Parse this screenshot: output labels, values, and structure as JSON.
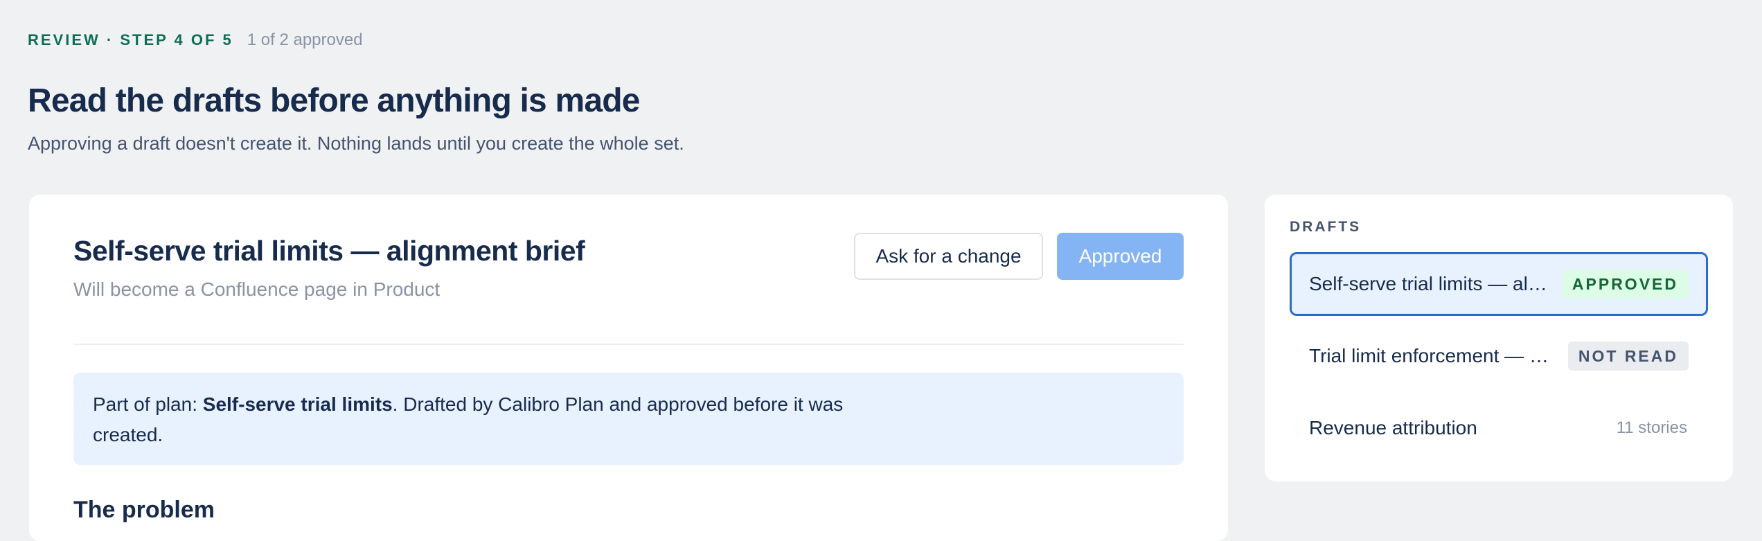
{
  "header": {
    "step_label": "REVIEW · STEP 4 OF 5",
    "approval_count": "1 of 2 approved",
    "title": "Read the drafts before anything is made",
    "subtitle": "Approving a draft doesn't create it. Nothing lands until you create the whole set."
  },
  "draft_detail": {
    "title": "Self-serve trial limits — alignment brief",
    "destination": "Will become a Confluence page in Product",
    "ask_change_label": "Ask for a change",
    "approved_label": "Approved",
    "notice": {
      "prefix": "Part of plan: ",
      "plan_name": "Self-serve trial limits",
      "suffix": ". Drafted by Calibro Plan and approved before it was created."
    },
    "section_heading": "The problem"
  },
  "drafts_panel": {
    "heading": "DRAFTS",
    "items": [
      {
        "name": "Self-serve trial limits — alignment brief",
        "status": "APPROVED"
      },
      {
        "name": "Trial limit enforcement — tickets",
        "status": "NOT READ"
      },
      {
        "name": "Revenue attribution",
        "meta": "11 stories"
      }
    ]
  },
  "colors": {
    "accent": "#2a6cc7",
    "eyebrow": "#0f6e56",
    "approved_button": "#84b4f4",
    "notice_bg": "#e8f1fe",
    "approved_badge_bg": "#dcfce7",
    "approved_badge_text": "#166534"
  }
}
